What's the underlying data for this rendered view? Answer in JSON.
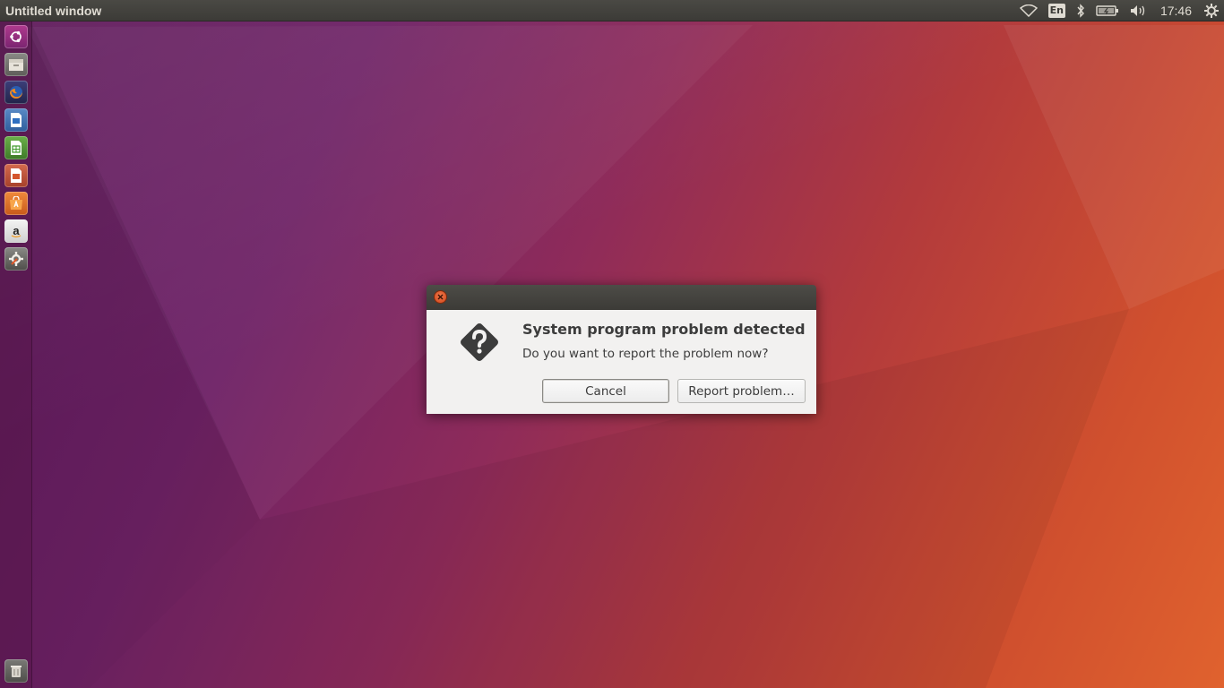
{
  "top_panel": {
    "window_title": "Untitled window",
    "keyboard_layout": "En",
    "clock": "17:46",
    "icons": [
      "wifi-icon",
      "keyboard-layout-indicator",
      "bluetooth-icon",
      "battery-icon",
      "volume-icon",
      "session-gear-icon"
    ]
  },
  "launcher": {
    "items": [
      {
        "name": "dash-home",
        "icon": "ubuntu-logo-icon"
      },
      {
        "name": "files",
        "icon": "file-manager-icon"
      },
      {
        "name": "firefox",
        "icon": "firefox-icon"
      },
      {
        "name": "libreoffice-writer",
        "icon": "writer-icon"
      },
      {
        "name": "libreoffice-calc",
        "icon": "calc-icon"
      },
      {
        "name": "libreoffice-impress",
        "icon": "impress-icon"
      },
      {
        "name": "ubuntu-software",
        "icon": "software-center-icon"
      },
      {
        "name": "amazon",
        "icon": "amazon-icon"
      },
      {
        "name": "system-settings",
        "icon": "settings-icon"
      },
      {
        "name": "trash",
        "icon": "trash-icon"
      }
    ]
  },
  "dialog": {
    "title": "System program problem detected",
    "message": "Do you want to report the problem now?",
    "cancel_label": "Cancel",
    "report_label": "Report problem…",
    "icon": "question-diamond-icon"
  },
  "colors": {
    "panel": "#3c3b37",
    "close_button": "#e05a2b",
    "dialog_bg": "#f2f1f0"
  }
}
